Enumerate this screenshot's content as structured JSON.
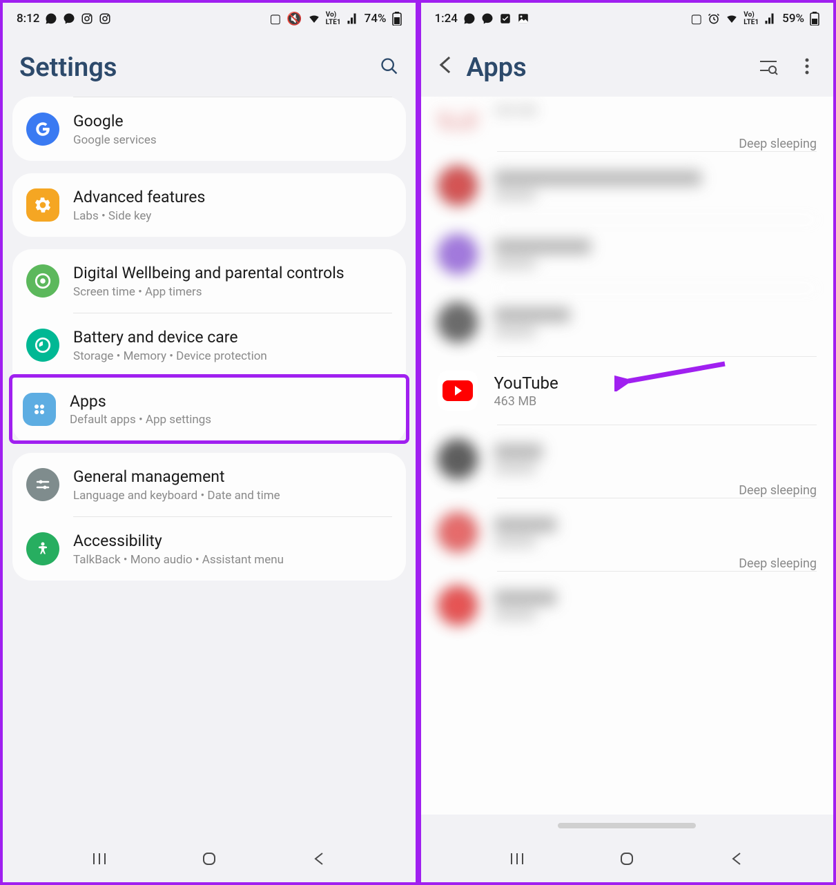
{
  "left": {
    "statusbar": {
      "time": "8:12",
      "battery": "74%"
    },
    "header": {
      "title": "Settings"
    },
    "groups": [
      {
        "items": [
          {
            "title": "Google",
            "sub": "Google services",
            "iconBg": "#3a7af2",
            "icon": "google"
          }
        ]
      },
      {
        "items": [
          {
            "title": "Advanced features",
            "sub": "Labs  •  Side key",
            "iconBg": "#f5a623",
            "icon": "gear"
          }
        ]
      },
      {
        "items": [
          {
            "title": "Digital Wellbeing and parental controls",
            "sub": "Screen time  •  App timers",
            "iconBg": "#4caf50",
            "icon": "wellbeing"
          },
          {
            "title": "Battery and device care",
            "sub": "Storage  •  Memory  •  Device protection",
            "iconBg": "#00b894",
            "icon": "battery"
          },
          {
            "title": "Apps",
            "sub": "Default apps  •  App settings",
            "iconBg": "#5dade2",
            "icon": "apps",
            "highlight": true
          }
        ]
      },
      {
        "items": [
          {
            "title": "General management",
            "sub": "Language and keyboard  •  Date and time",
            "iconBg": "#7f8c8d",
            "icon": "sliders"
          },
          {
            "title": "Accessibility",
            "sub": "TalkBack  •  Mono audio  •  Assistant menu",
            "iconBg": "#27ae60",
            "icon": "accessibility"
          }
        ]
      }
    ]
  },
  "right": {
    "statusbar": {
      "time": "1:24",
      "battery": "59%"
    },
    "header": {
      "title": "Apps"
    },
    "partial": {
      "sub": "308 MB",
      "badge": "Deep sleeping"
    },
    "apps": [
      {
        "title": "████████████████",
        "sub": "████",
        "blurred": true,
        "iconColor": "#d14848"
      },
      {
        "title": "██████████",
        "sub": "████",
        "blurred": true,
        "iconColor": "#8e5acb"
      },
      {
        "title": "████████",
        "sub": "████",
        "blurred": true,
        "iconColor": "#4a4a4a"
      },
      {
        "title": "YouTube",
        "sub": "463 MB",
        "blurred": false,
        "iconColor": "#ff0000",
        "arrow": true
      },
      {
        "title": "████",
        "sub": "████",
        "blurred": true,
        "iconColor": "#3a3a3a",
        "badge": "Deep sleeping"
      },
      {
        "title": "██████",
        "sub": "████",
        "blurred": true,
        "iconColor": "#d14848",
        "badge": "Deep sleeping"
      },
      {
        "title": "██████",
        "sub": "████",
        "blurred": true,
        "iconColor": "#e04040"
      }
    ]
  }
}
